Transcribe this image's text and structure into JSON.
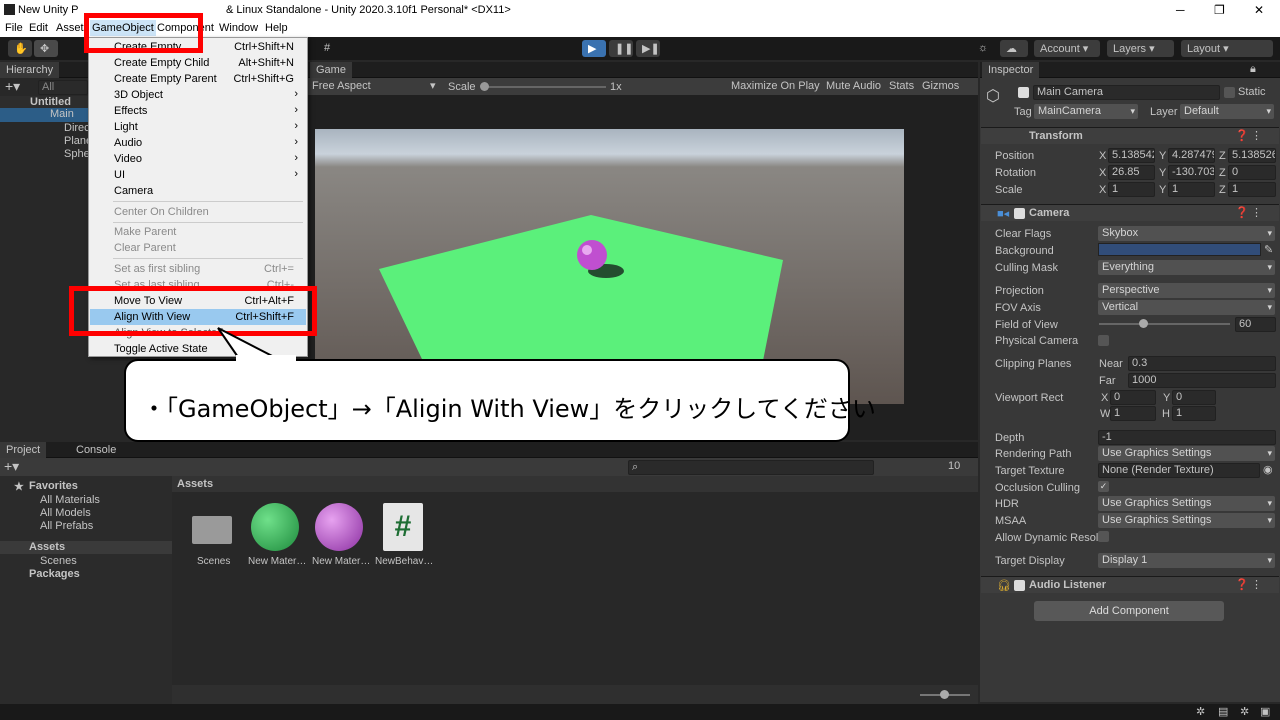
{
  "titlebar": {
    "title": "New Unity P",
    "title_tail": "& Linux Standalone - Unity 2020.3.10f1 Personal* <DX11>",
    "min": "─",
    "max": "❐",
    "close": "✕"
  },
  "menubar": {
    "file": "File",
    "edit": "Edit",
    "assets": "Assets",
    "gameobject": "GameObject",
    "component": "Component",
    "window": "Window",
    "help": "Help"
  },
  "toolbar": {
    "account": "Account",
    "layers": "Layers",
    "layout": "Layout"
  },
  "hierarchy": {
    "tab": "Hierarchy",
    "search": "All",
    "scene": "Untitled",
    "items": [
      "Main",
      "Direc",
      "Plane",
      "Sphe"
    ]
  },
  "game": {
    "tab": "Game",
    "aspect": "Free Aspect",
    "scale_label": "Scale",
    "scale_value": "1x",
    "maximize": "Maximize On Play",
    "mute": "Mute Audio",
    "stats": "Stats",
    "gizmos": "Gizmos"
  },
  "menu": {
    "create_empty": "Create Empty",
    "create_empty_sc": "Ctrl+Shift+N",
    "create_child": "Create Empty Child",
    "create_child_sc": "Alt+Shift+N",
    "create_parent": "Create Empty Parent",
    "create_parent_sc": "Ctrl+Shift+G",
    "obj3d": "3D Object",
    "effects": "Effects",
    "light": "Light",
    "audio": "Audio",
    "video": "Video",
    "ui": "UI",
    "camera": "Camera",
    "center": "Center On Children",
    "make_parent": "Make Parent",
    "clear_parent": "Clear Parent",
    "first_sibling": "Set as first sibling",
    "first_sibling_sc": "Ctrl+=",
    "last_sibling": "Set as last sibling",
    "last_sibling_sc": "Ctrl+-",
    "move_to_view": "Move To View",
    "move_to_view_sc": "Ctrl+Alt+F",
    "align_with_view": "Align With View",
    "align_with_view_sc": "Ctrl+Shift+F",
    "align_view_to_selected": "Align View to Selected",
    "toggle_active": "Toggle Active State"
  },
  "callout": "・「GameObject」→「Aligin With View」をクリックしてください",
  "project": {
    "tab_project": "Project",
    "tab_console": "Console",
    "favorites": "Favorites",
    "all_materials": "All Materials",
    "all_models": "All Models",
    "all_prefabs": "All Prefabs",
    "assets": "Assets",
    "scenes": "Scenes",
    "packages": "Packages",
    "assets_header": "Assets",
    "hidden_count": "10",
    "files": [
      "Scenes",
      "New Mater…",
      "New Mater…",
      "NewBehav…"
    ]
  },
  "inspector": {
    "tab": "Inspector",
    "name": "Main Camera",
    "static": "Static",
    "tag_label": "Tag",
    "tag": "MainCamera",
    "layer_label": "Layer",
    "layer": "Default",
    "transform": "Transform",
    "position": "Position",
    "rotation": "Rotation",
    "scale": "Scale",
    "pos": [
      "5.138542",
      "4.287479",
      "5.138526"
    ],
    "rot": [
      "26.85",
      "-130.703",
      "0"
    ],
    "scl": [
      "1",
      "1",
      "1"
    ],
    "camera": "Camera",
    "clear_flags": "Clear Flags",
    "clear_flags_v": "Skybox",
    "background": "Background",
    "culling": "Culling Mask",
    "culling_v": "Everything",
    "projection": "Projection",
    "projection_v": "Perspective",
    "fov_axis": "FOV Axis",
    "fov_axis_v": "Vertical",
    "fov": "Field of View",
    "fov_v": "60",
    "physical": "Physical Camera",
    "clipping": "Clipping Planes",
    "near": "Near",
    "near_v": "0.3",
    "far": "Far",
    "far_v": "1000",
    "viewport": "Viewport Rect",
    "vx": "0",
    "vy": "0",
    "vw": "1",
    "vh": "1",
    "depth": "Depth",
    "depth_v": "-1",
    "render_path": "Rendering Path",
    "render_path_v": "Use Graphics Settings",
    "target_tex": "Target Texture",
    "target_tex_v": "None (Render Texture)",
    "occlusion": "Occlusion Culling",
    "hdr": "HDR",
    "hdr_v": "Use Graphics Settings",
    "msaa": "MSAA",
    "msaa_v": "Use Graphics Settings",
    "dyn_res": "Allow Dynamic Resol",
    "target_display": "Target Display",
    "target_display_v": "Display 1",
    "audio_listener": "Audio Listener",
    "add_component": "Add Component"
  },
  "colors": {
    "accent": "#ff0000",
    "selected": "#99c9ef",
    "background_color": "#314d79",
    "plane": "#5bf07b",
    "sphere": "#c04fd0"
  }
}
